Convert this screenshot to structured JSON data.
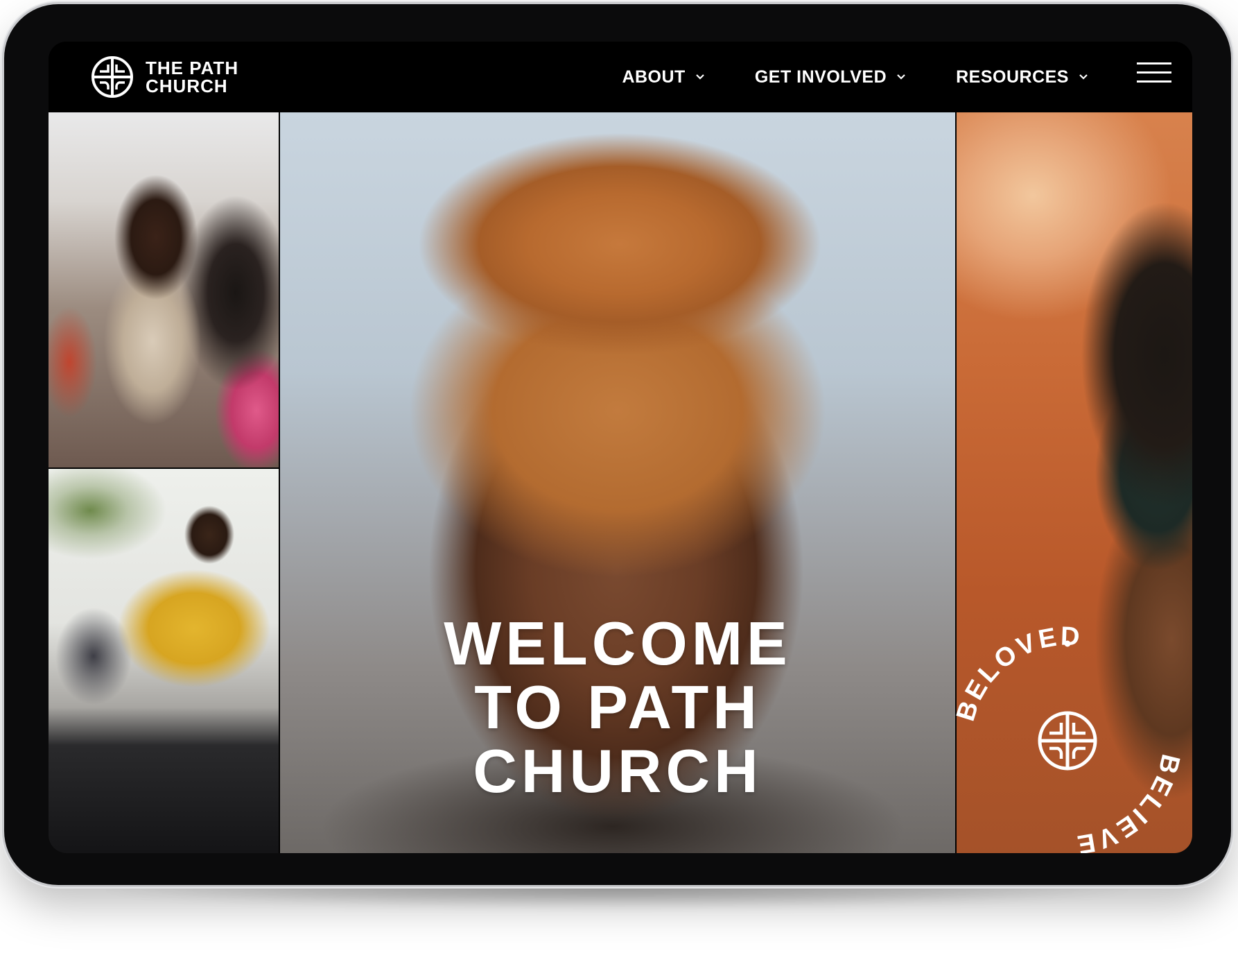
{
  "brand": {
    "line1": "THE PATH",
    "line2": "CHURCH",
    "logo_icon": "path-cross-logo-icon"
  },
  "nav": {
    "items": [
      {
        "label": "ABOUT",
        "icon": "chevron-down-icon"
      },
      {
        "label": "GET INVOLVED",
        "icon": "chevron-down-icon"
      },
      {
        "label": "RESOURCES",
        "icon": "chevron-down-icon"
      }
    ],
    "menu_icon": "hamburger-menu-icon"
  },
  "hero": {
    "headline_lines": [
      "WELCOME",
      "TO PATH",
      "CHURCH"
    ]
  },
  "badge": {
    "words": [
      "BELOVED",
      "BELIEVE"
    ],
    "icon": "path-cross-logo-icon"
  },
  "colors": {
    "navbar_bg": "#000000",
    "text": "#ffffff",
    "device_frame": "#0b0b0c"
  }
}
